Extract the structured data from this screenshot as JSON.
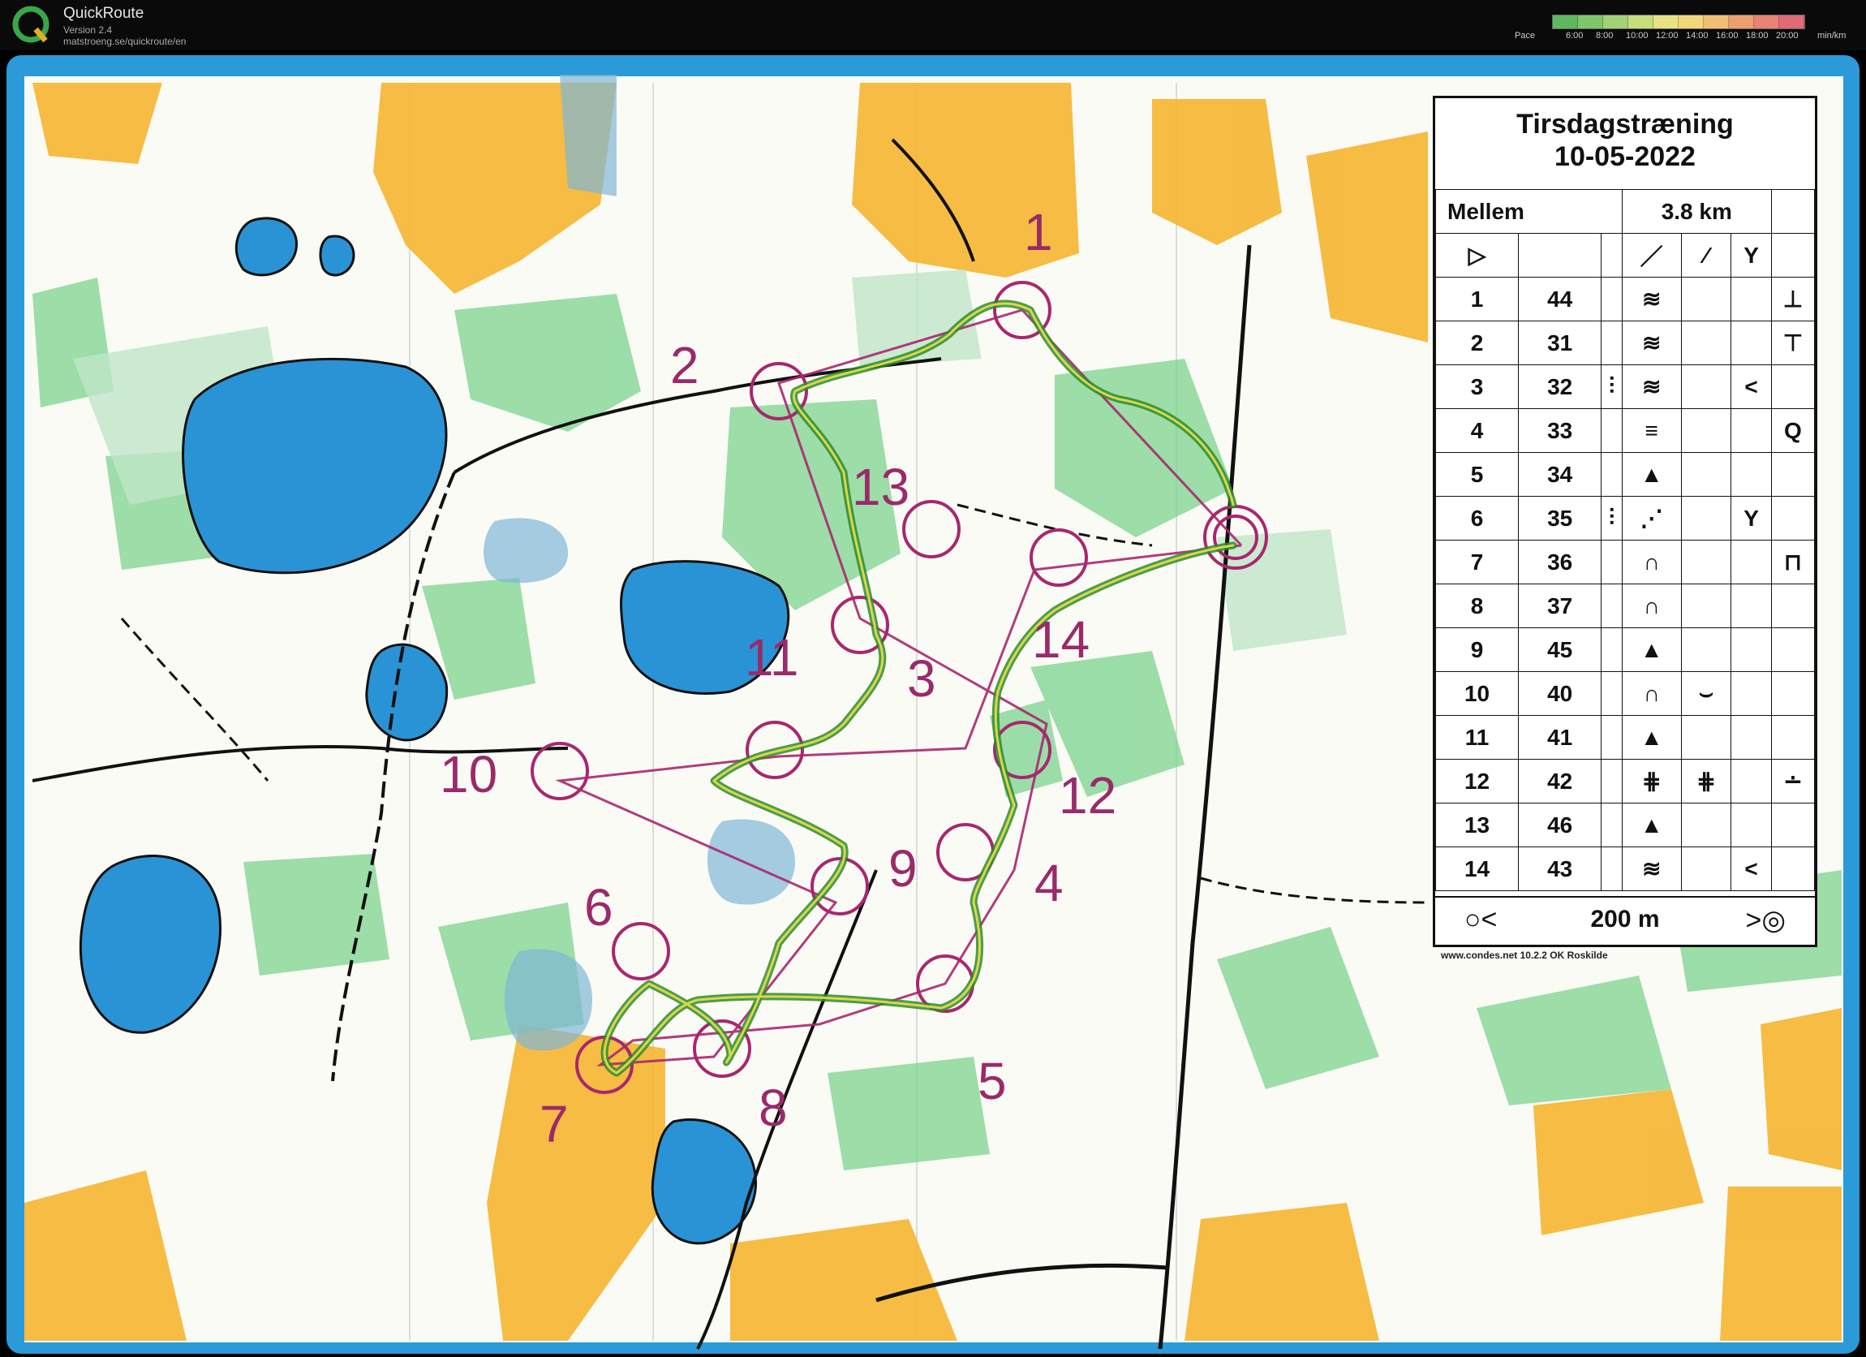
{
  "app": {
    "name": "QuickRoute",
    "version": "Version 2.4",
    "url": "matstroeng.se/quickroute/en"
  },
  "pace": {
    "label": "Pace",
    "ticks": [
      "6:00",
      "8:00",
      "10:00",
      "12:00",
      "14:00",
      "16:00",
      "18:00",
      "20:00"
    ],
    "unit": "min/km",
    "colors": [
      "#5fb85f",
      "#7fc66a",
      "#a2d275",
      "#c6de7e",
      "#e6e482",
      "#f2d67a",
      "#f1bf73",
      "#eca06f",
      "#e88272",
      "#e06a78"
    ]
  },
  "legend": {
    "title_line1": "Tirsdagstræning",
    "title_line2": "10-05-2022",
    "course": "Mellem",
    "length": "3.8 km",
    "controls": [
      {
        "num": "1",
        "code": "44"
      },
      {
        "num": "2",
        "code": "31"
      },
      {
        "num": "3",
        "code": "32"
      },
      {
        "num": "4",
        "code": "33"
      },
      {
        "num": "5",
        "code": "34"
      },
      {
        "num": "6",
        "code": "35"
      },
      {
        "num": "7",
        "code": "36"
      },
      {
        "num": "8",
        "code": "37"
      },
      {
        "num": "9",
        "code": "45"
      },
      {
        "num": "10",
        "code": "40"
      },
      {
        "num": "11",
        "code": "41"
      },
      {
        "num": "12",
        "code": "42"
      },
      {
        "num": "13",
        "code": "46"
      },
      {
        "num": "14",
        "code": "43"
      }
    ],
    "scale": "200 m",
    "credit": "www.condes.net 10.2.2 OK Roskilde"
  },
  "course_numbers": [
    "1",
    "2",
    "3",
    "4",
    "5",
    "6",
    "7",
    "8",
    "9",
    "10",
    "11",
    "12",
    "13",
    "14"
  ],
  "map_colors": {
    "water": "#2a93d5",
    "open_land": "#f5b634",
    "forest_green": "#6fcf82",
    "course_purple": "#a8276e",
    "route_green": "#2e8b2e",
    "route_yellow": "#d8d84a"
  }
}
